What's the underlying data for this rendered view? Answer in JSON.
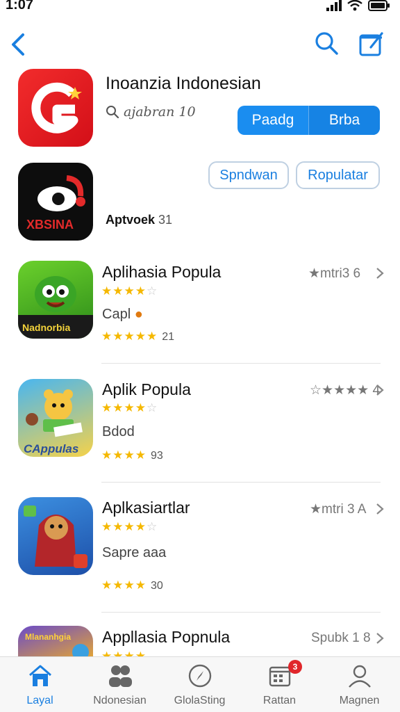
{
  "status_bar": {
    "time": "1:07"
  },
  "header": {
    "title": "Inoanzia Indonesian",
    "subtitle": "ajabran 10",
    "segments": [
      "Paadg",
      "Brba"
    ],
    "pills": [
      "Spndwan",
      "Ropulatar"
    ]
  },
  "developer": {
    "name": "Aptvoek",
    "count": "31",
    "icon_text": "XBSINA"
  },
  "apps": [
    {
      "title": "Aplihasia Popula",
      "meta": "★mtri3 6",
      "rating": "4/5 stars",
      "subtitle": "Capl",
      "score": "5 stars",
      "reviews": "21",
      "icon_text": "Nadnorbia"
    },
    {
      "title": "Aplik Popula",
      "meta": "☆★★★★ 4",
      "rating": "4/5 stars",
      "subtitle": "Bdod",
      "score": "3.5 stars",
      "reviews": "93",
      "icon_text": "CAppulas"
    },
    {
      "title": "Aplkasiartlar",
      "meta": "★mtri 3 A",
      "rating": "4/5 stars",
      "subtitle": "Sapre aaa",
      "score": "3.5 stars",
      "reviews": "30"
    },
    {
      "title": "Appllasia Popnula",
      "meta": "Spubk 1 8",
      "icon_text": "Mlananhgia"
    }
  ],
  "tabs": [
    {
      "label": "Layal",
      "icon": "home-icon",
      "active": true
    },
    {
      "label": "Ndonesian",
      "icon": "people-icon"
    },
    {
      "label": "GlolaSting",
      "icon": "compass-icon"
    },
    {
      "label": "Rattan",
      "icon": "updates-icon",
      "badge": "3"
    },
    {
      "label": "Magnen",
      "icon": "profile-icon"
    }
  ],
  "colors": {
    "accent": "#1a8df0",
    "star": "#f5b800",
    "badge": "#e0262a"
  }
}
